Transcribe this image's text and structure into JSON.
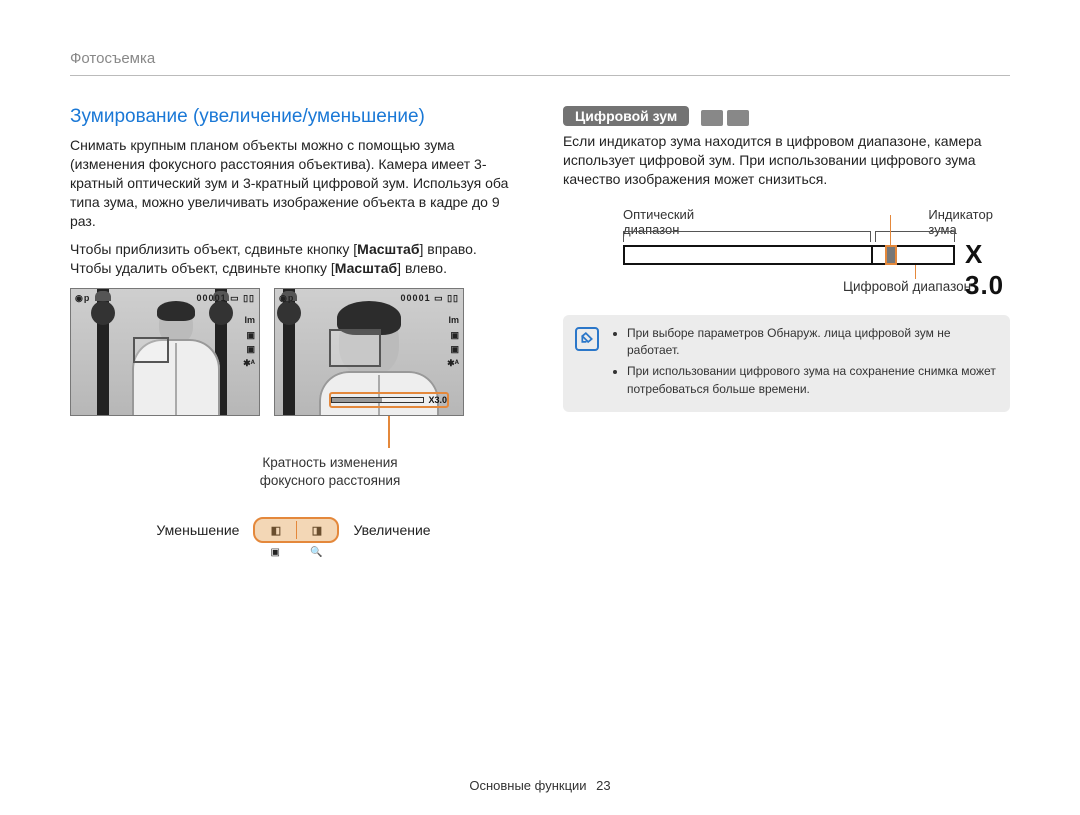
{
  "breadcrumb": "Фотосъемка",
  "left": {
    "title": "Зумирование (увеличение/уменьшение)",
    "para1": "Снимать крупным планом объекты можно с помощью зума (изменения фокусного расстояния объектива). Камера имеет 3-кратный оптический зум и 3-кратный цифровой зум. Используя оба типа зума, можно увеличивать изображение объекта в кадре до 9 раз.",
    "para2a": "Чтобы приблизить объект, сдвиньте кнопку [",
    "para2b": "Масштаб",
    "para2c": "] вправо. Чтобы удалить объект, сдвиньте кнопку [",
    "para2d": "Масштаб",
    "para2e": "] влево.",
    "shot_counter": "00001",
    "zoom_mini_label": "X3.0",
    "caption_zoomfactor_l1": "Кратность изменения",
    "caption_zoomfactor_l2": "фокусного расстояния",
    "zc_decrease": "Уменьшение",
    "zc_increase": "Увеличение",
    "zc_btn_left": "◧",
    "zc_btn_right": "◨"
  },
  "right": {
    "pill": "Цифровой зум",
    "para": "Если индикатор зума находится в цифровом диапазоне, камера использует цифровой зум. При использовании цифрового зума качество изображения может снизиться.",
    "lbl_optical": "Оптический диапазон",
    "lbl_indicator": "Индикатор зума",
    "lbl_digital": "Цифровой диапазон",
    "mult": "X 3.0",
    "note1": "При выборе параметров Обнаруж. лица цифровой зум не работает.",
    "note2": "При использовании цифрового зума на сохранение снимка может потребоваться больше времени."
  },
  "footer": {
    "section": "Основные функции",
    "page": "23"
  }
}
